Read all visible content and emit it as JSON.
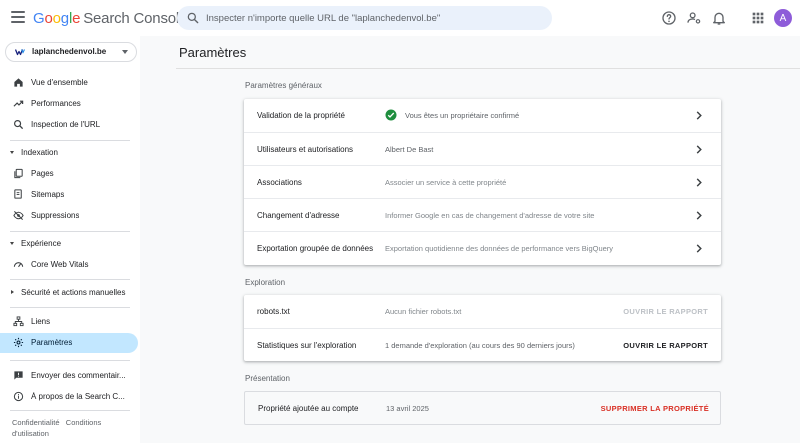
{
  "header": {
    "logo": {
      "g1": "G",
      "g2": "o",
      "g3": "o",
      "g4": "g",
      "g5": "l",
      "g6": "e",
      "product": "Search Console"
    },
    "search_placeholder": "Inspecter n'importe quelle URL de \"laplanchedenvol.be\"",
    "icons": [
      "help-icon",
      "manage-users-icon",
      "notifications-icon",
      "apps-grid-icon"
    ],
    "avatar_letter": "A",
    "avatar_color": "#8e5cd9"
  },
  "sidebar": {
    "property": "laplanchedenvol.be",
    "items_top": [
      {
        "label": "Vue d'ensemble",
        "icon": "home-icon"
      },
      {
        "label": "Performances",
        "icon": "trending-up-icon"
      },
      {
        "label": "Inspection de l'URL",
        "icon": "search-icon"
      }
    ],
    "indexation": {
      "header": "Indexation",
      "items": [
        {
          "label": "Pages",
          "icon": "pages-icon"
        },
        {
          "label": "Sitemaps",
          "icon": "sitemap-icon"
        },
        {
          "label": "Suppressions",
          "icon": "visibility-off-icon"
        }
      ]
    },
    "experience": {
      "header": "Expérience",
      "items": [
        {
          "label": "Core Web Vitals",
          "icon": "speed-gauge-icon"
        }
      ]
    },
    "security_header": "Sécurité et actions manuelles",
    "items_bottom": [
      {
        "label": "Liens",
        "icon": "links-icon"
      },
      {
        "label": "Paramètres",
        "icon": "settings-icon",
        "active": true
      }
    ],
    "items_footer": [
      {
        "label": "Envoyer des commentair...",
        "icon": "feedback-icon"
      },
      {
        "label": "À propos de la Search C...",
        "icon": "info-icon"
      }
    ],
    "footer": {
      "privacy": "Confidentialité",
      "terms": "Conditions",
      "usage": "d'utilisation"
    }
  },
  "main": {
    "title": "Paramètres",
    "general": {
      "title": "Paramètres généraux",
      "rows": [
        {
          "label": "Validation de la propriété",
          "value": "Vous êtes un propriétaire confirmé"
        },
        {
          "label": "Utilisateurs et autorisations",
          "value": "Albert De Bast"
        },
        {
          "label": "Associations",
          "value": "Associer un service à cette propriété"
        },
        {
          "label": "Changement d'adresse",
          "value": "Informer Google en cas de changement d'adresse de votre site"
        },
        {
          "label": "Exportation groupée de données",
          "value": "Exportation quotidienne des données de performance vers BigQuery"
        }
      ]
    },
    "exploration": {
      "title": "Exploration",
      "rows": [
        {
          "label": "robots.txt",
          "value": "Aucun fichier robots.txt",
          "action": "OUVRIR LE RAPPORT",
          "action_enabled": false
        },
        {
          "label": "Statistiques sur l'exploration",
          "value": "1 demande d'exploration (au cours des 90 derniers jours)",
          "action": "OUVRIR LE RAPPORT",
          "action_enabled": true
        }
      ]
    },
    "presentation": {
      "title": "Présentation",
      "row": {
        "label": "Propriété ajoutée au compte",
        "value": "13 avril 2025",
        "action": "SUPPRIMER LA PROPRIÉTÉ"
      }
    }
  },
  "colors": {
    "active_nav": "#c2e7ff",
    "check_green": "#1e8e3e",
    "danger": "#d93025",
    "search_bg": "#eaf1fb"
  }
}
